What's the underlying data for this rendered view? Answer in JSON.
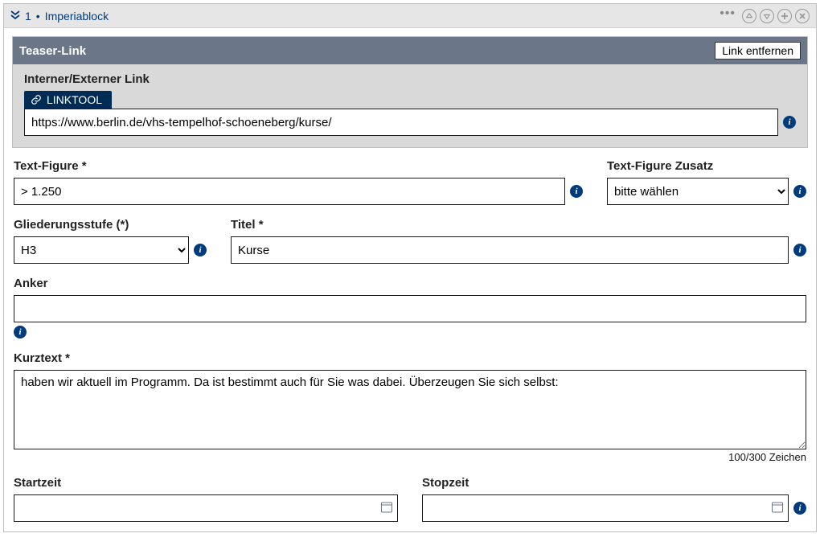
{
  "header": {
    "index": "1",
    "dot": "•",
    "title": "Imperiablock"
  },
  "teaser": {
    "title": "Teaser-Link",
    "removeBtn": "Link entfernen",
    "linkLabel": "Interner/Externer Link",
    "linktoolBtn": "LINKTOOL",
    "url": "https://www.berlin.de/vhs-tempelhof-schoeneberg/kurse/"
  },
  "fields": {
    "textFigure": {
      "label": "Text-Figure *",
      "value": "> 1.250"
    },
    "textFigureZusatz": {
      "label": "Text-Figure Zusatz",
      "selected": "bitte wählen"
    },
    "gliederung": {
      "label": "Gliederungsstufe (*)",
      "selected": "H3"
    },
    "titel": {
      "label": "Titel *",
      "value": "Kurse"
    },
    "anker": {
      "label": "Anker",
      "value": ""
    },
    "kurztext": {
      "label": "Kurztext *",
      "value": "haben wir aktuell im Programm. Da ist bestimmt auch für Sie was dabei. Überzeugen Sie sich selbst:",
      "counter": "100/300 Zeichen"
    },
    "startzeit": {
      "label": "Startzeit",
      "value": ""
    },
    "stopzeit": {
      "label": "Stopzeit",
      "value": ""
    }
  },
  "infoGlyph": "i"
}
